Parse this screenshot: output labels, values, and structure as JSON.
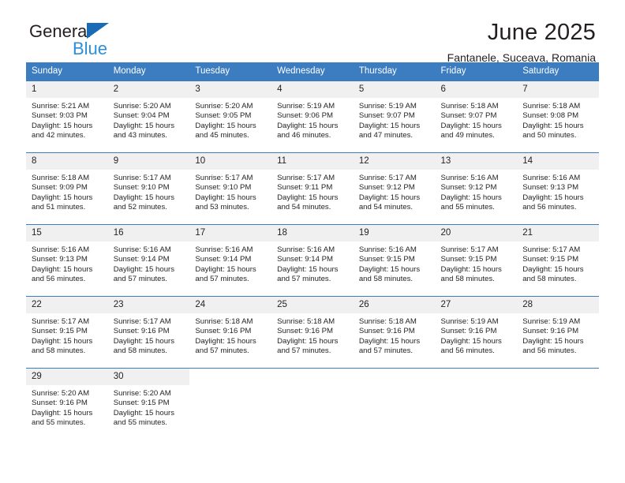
{
  "brand": {
    "name_top": "General",
    "name_bottom": "Blue",
    "triangle_color": "#1a6bb5",
    "blue_color": "#2b8fd9"
  },
  "header": {
    "title": "June 2025",
    "subtitle": "Fantanele, Suceava, Romania"
  },
  "theme": {
    "header_blue": "#3b7dc0",
    "daynum_gray": "#f0f0f0",
    "text": "#231f20"
  },
  "weekdays": [
    "Sunday",
    "Monday",
    "Tuesday",
    "Wednesday",
    "Thursday",
    "Friday",
    "Saturday"
  ],
  "weeks": [
    [
      {
        "day": "1",
        "sunrise": "Sunrise: 5:21 AM",
        "sunset": "Sunset: 9:03 PM",
        "daylight1": "Daylight: 15 hours",
        "daylight2": "and 42 minutes."
      },
      {
        "day": "2",
        "sunrise": "Sunrise: 5:20 AM",
        "sunset": "Sunset: 9:04 PM",
        "daylight1": "Daylight: 15 hours",
        "daylight2": "and 43 minutes."
      },
      {
        "day": "3",
        "sunrise": "Sunrise: 5:20 AM",
        "sunset": "Sunset: 9:05 PM",
        "daylight1": "Daylight: 15 hours",
        "daylight2": "and 45 minutes."
      },
      {
        "day": "4",
        "sunrise": "Sunrise: 5:19 AM",
        "sunset": "Sunset: 9:06 PM",
        "daylight1": "Daylight: 15 hours",
        "daylight2": "and 46 minutes."
      },
      {
        "day": "5",
        "sunrise": "Sunrise: 5:19 AM",
        "sunset": "Sunset: 9:07 PM",
        "daylight1": "Daylight: 15 hours",
        "daylight2": "and 47 minutes."
      },
      {
        "day": "6",
        "sunrise": "Sunrise: 5:18 AM",
        "sunset": "Sunset: 9:07 PM",
        "daylight1": "Daylight: 15 hours",
        "daylight2": "and 49 minutes."
      },
      {
        "day": "7",
        "sunrise": "Sunrise: 5:18 AM",
        "sunset": "Sunset: 9:08 PM",
        "daylight1": "Daylight: 15 hours",
        "daylight2": "and 50 minutes."
      }
    ],
    [
      {
        "day": "8",
        "sunrise": "Sunrise: 5:18 AM",
        "sunset": "Sunset: 9:09 PM",
        "daylight1": "Daylight: 15 hours",
        "daylight2": "and 51 minutes."
      },
      {
        "day": "9",
        "sunrise": "Sunrise: 5:17 AM",
        "sunset": "Sunset: 9:10 PM",
        "daylight1": "Daylight: 15 hours",
        "daylight2": "and 52 minutes."
      },
      {
        "day": "10",
        "sunrise": "Sunrise: 5:17 AM",
        "sunset": "Sunset: 9:10 PM",
        "daylight1": "Daylight: 15 hours",
        "daylight2": "and 53 minutes."
      },
      {
        "day": "11",
        "sunrise": "Sunrise: 5:17 AM",
        "sunset": "Sunset: 9:11 PM",
        "daylight1": "Daylight: 15 hours",
        "daylight2": "and 54 minutes."
      },
      {
        "day": "12",
        "sunrise": "Sunrise: 5:17 AM",
        "sunset": "Sunset: 9:12 PM",
        "daylight1": "Daylight: 15 hours",
        "daylight2": "and 54 minutes."
      },
      {
        "day": "13",
        "sunrise": "Sunrise: 5:16 AM",
        "sunset": "Sunset: 9:12 PM",
        "daylight1": "Daylight: 15 hours",
        "daylight2": "and 55 minutes."
      },
      {
        "day": "14",
        "sunrise": "Sunrise: 5:16 AM",
        "sunset": "Sunset: 9:13 PM",
        "daylight1": "Daylight: 15 hours",
        "daylight2": "and 56 minutes."
      }
    ],
    [
      {
        "day": "15",
        "sunrise": "Sunrise: 5:16 AM",
        "sunset": "Sunset: 9:13 PM",
        "daylight1": "Daylight: 15 hours",
        "daylight2": "and 56 minutes."
      },
      {
        "day": "16",
        "sunrise": "Sunrise: 5:16 AM",
        "sunset": "Sunset: 9:14 PM",
        "daylight1": "Daylight: 15 hours",
        "daylight2": "and 57 minutes."
      },
      {
        "day": "17",
        "sunrise": "Sunrise: 5:16 AM",
        "sunset": "Sunset: 9:14 PM",
        "daylight1": "Daylight: 15 hours",
        "daylight2": "and 57 minutes."
      },
      {
        "day": "18",
        "sunrise": "Sunrise: 5:16 AM",
        "sunset": "Sunset: 9:14 PM",
        "daylight1": "Daylight: 15 hours",
        "daylight2": "and 57 minutes."
      },
      {
        "day": "19",
        "sunrise": "Sunrise: 5:16 AM",
        "sunset": "Sunset: 9:15 PM",
        "daylight1": "Daylight: 15 hours",
        "daylight2": "and 58 minutes."
      },
      {
        "day": "20",
        "sunrise": "Sunrise: 5:17 AM",
        "sunset": "Sunset: 9:15 PM",
        "daylight1": "Daylight: 15 hours",
        "daylight2": "and 58 minutes."
      },
      {
        "day": "21",
        "sunrise": "Sunrise: 5:17 AM",
        "sunset": "Sunset: 9:15 PM",
        "daylight1": "Daylight: 15 hours",
        "daylight2": "and 58 minutes."
      }
    ],
    [
      {
        "day": "22",
        "sunrise": "Sunrise: 5:17 AM",
        "sunset": "Sunset: 9:15 PM",
        "daylight1": "Daylight: 15 hours",
        "daylight2": "and 58 minutes."
      },
      {
        "day": "23",
        "sunrise": "Sunrise: 5:17 AM",
        "sunset": "Sunset: 9:16 PM",
        "daylight1": "Daylight: 15 hours",
        "daylight2": "and 58 minutes."
      },
      {
        "day": "24",
        "sunrise": "Sunrise: 5:18 AM",
        "sunset": "Sunset: 9:16 PM",
        "daylight1": "Daylight: 15 hours",
        "daylight2": "and 57 minutes."
      },
      {
        "day": "25",
        "sunrise": "Sunrise: 5:18 AM",
        "sunset": "Sunset: 9:16 PM",
        "daylight1": "Daylight: 15 hours",
        "daylight2": "and 57 minutes."
      },
      {
        "day": "26",
        "sunrise": "Sunrise: 5:18 AM",
        "sunset": "Sunset: 9:16 PM",
        "daylight1": "Daylight: 15 hours",
        "daylight2": "and 57 minutes."
      },
      {
        "day": "27",
        "sunrise": "Sunrise: 5:19 AM",
        "sunset": "Sunset: 9:16 PM",
        "daylight1": "Daylight: 15 hours",
        "daylight2": "and 56 minutes."
      },
      {
        "day": "28",
        "sunrise": "Sunrise: 5:19 AM",
        "sunset": "Sunset: 9:16 PM",
        "daylight1": "Daylight: 15 hours",
        "daylight2": "and 56 minutes."
      }
    ],
    [
      {
        "day": "29",
        "sunrise": "Sunrise: 5:20 AM",
        "sunset": "Sunset: 9:16 PM",
        "daylight1": "Daylight: 15 hours",
        "daylight2": "and 55 minutes."
      },
      {
        "day": "30",
        "sunrise": "Sunrise: 5:20 AM",
        "sunset": "Sunset: 9:15 PM",
        "daylight1": "Daylight: 15 hours",
        "daylight2": "and 55 minutes."
      },
      {
        "day": "",
        "sunrise": "",
        "sunset": "",
        "daylight1": "",
        "daylight2": ""
      },
      {
        "day": "",
        "sunrise": "",
        "sunset": "",
        "daylight1": "",
        "daylight2": ""
      },
      {
        "day": "",
        "sunrise": "",
        "sunset": "",
        "daylight1": "",
        "daylight2": ""
      },
      {
        "day": "",
        "sunrise": "",
        "sunset": "",
        "daylight1": "",
        "daylight2": ""
      },
      {
        "day": "",
        "sunrise": "",
        "sunset": "",
        "daylight1": "",
        "daylight2": ""
      }
    ]
  ]
}
